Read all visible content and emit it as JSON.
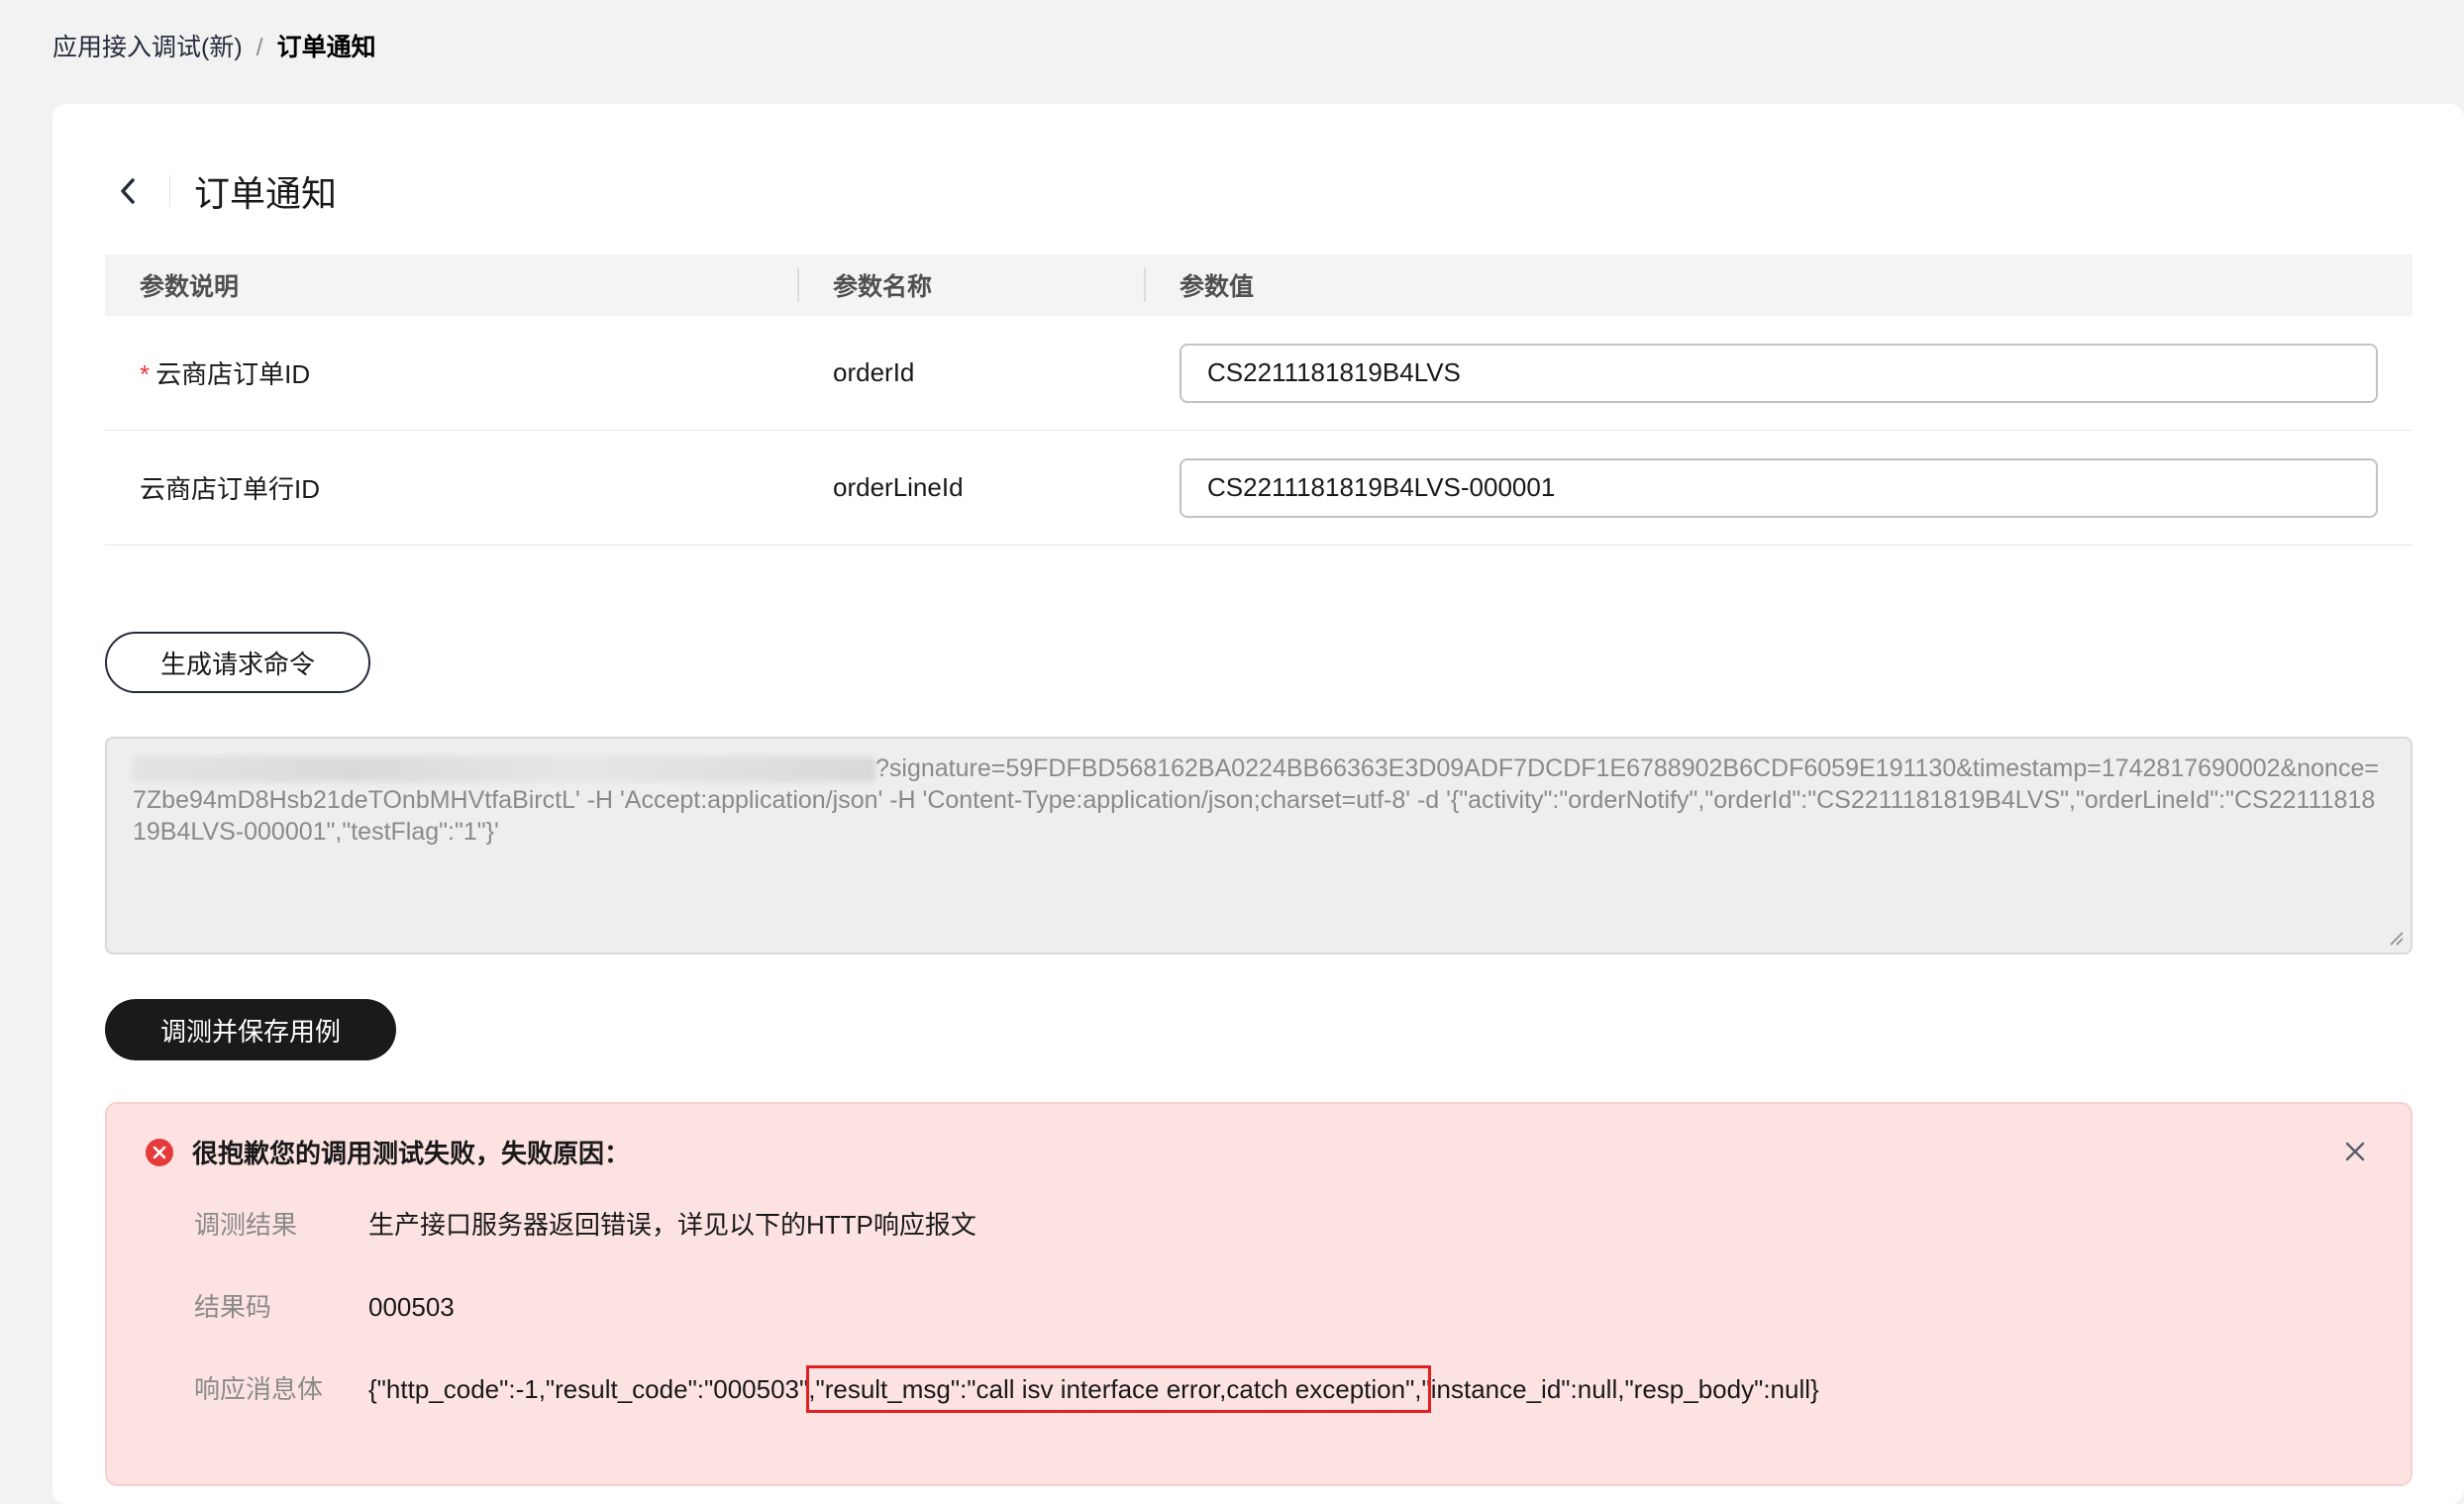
{
  "breadcrumb": {
    "parent": "应用接入调试(新)",
    "separator": "/",
    "current": "订单通知"
  },
  "page": {
    "title": "订单通知"
  },
  "table": {
    "headers": [
      "参数说明",
      "参数名称",
      "参数值"
    ],
    "rows": [
      {
        "desc": "云商店订单ID",
        "required": true,
        "name": "orderId",
        "value": "CS2211181819B4LVS"
      },
      {
        "desc": "云商店订单行ID",
        "required": false,
        "name": "orderLineId",
        "value": "CS2211181819B4LVS-000001"
      }
    ]
  },
  "actions": {
    "generate_label": "生成请求命令",
    "test_label": "调测并保存用例"
  },
  "command": {
    "text": "?signature=59FDFBD568162BA0224BB66363E3D09ADF7DCDF1E6788902B6CDF6059E191130&timestamp=1742817690002&nonce=7Zbe94mD8Hsb21deTOnbMHVtfaBirctL' -H 'Accept:application/json' -H 'Content-Type:application/json;charset=utf-8' -d '{\"activity\":\"orderNotify\",\"orderId\":\"CS2211181819B4LVS\",\"orderLineId\":\"CS2211181819B4LVS-000001\",\"testFlag\":\"1\"}'"
  },
  "error": {
    "title": "很抱歉您的调用测试失败，失败原因：",
    "result_label": "调测结果",
    "result_value": "生产接口服务器返回错误，详见以下的HTTP响应报文",
    "code_label": "结果码",
    "code_value": "000503",
    "body_label": "响应消息体",
    "body_prefix": "{\"http_code\":-1,\"result_code\":\"000503\",",
    "body_highlight": "\"result_msg\":\"call isv interface error,catch exception\",",
    "body_suffix": "\"instance_id\":null,\"resp_body\":null}"
  },
  "colors": {
    "primary": "#1a1a1a",
    "error_bg": "#fde2e2",
    "error_icon": "#e6393c",
    "highlight_box": "#e02020",
    "required_star": "#e6393c"
  }
}
